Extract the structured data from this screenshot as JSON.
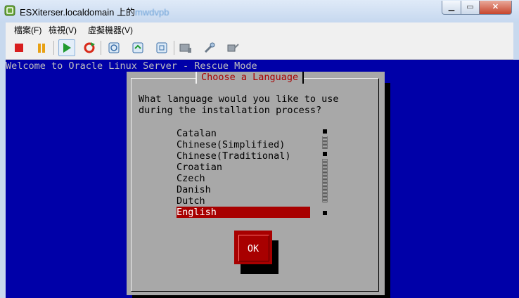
{
  "window": {
    "title": "ESXiterser.localdomain 上的",
    "title_tail": "mwdvpb"
  },
  "menu": {
    "items": [
      "檔案(F)",
      "檢視(V)",
      "虛擬機器(V)"
    ]
  },
  "toolbar": {
    "buttons": [
      "stop-icon",
      "pause-icon",
      "play-icon",
      "reset-icon",
      "snapshot-take-icon",
      "snapshot-revert-icon",
      "snapshot-manager-icon",
      "vm-settings-icon",
      "tools-icon",
      "connect-icon"
    ],
    "colors": {
      "stop": "#d81e1e",
      "pause": "#e8a012",
      "play": "#1f9a2e",
      "reset": "#d82a1a"
    }
  },
  "console": {
    "header": "Welcome to Oracle Linux Server - Rescue Mode",
    "dialog": {
      "title": "Choose a Language",
      "question_line1": "What language would you like to use",
      "question_line2": "during the installation process?",
      "languages": [
        "Catalan",
        "Chinese(Simplified)",
        "Chinese(Traditional)",
        "Croatian",
        "Czech",
        "Danish",
        "Dutch",
        "English"
      ],
      "selected": "English",
      "ok_label": "OK"
    },
    "colors": {
      "background": "#0000a8",
      "dialog": "#a8a8a8",
      "accent": "#a80000"
    }
  }
}
